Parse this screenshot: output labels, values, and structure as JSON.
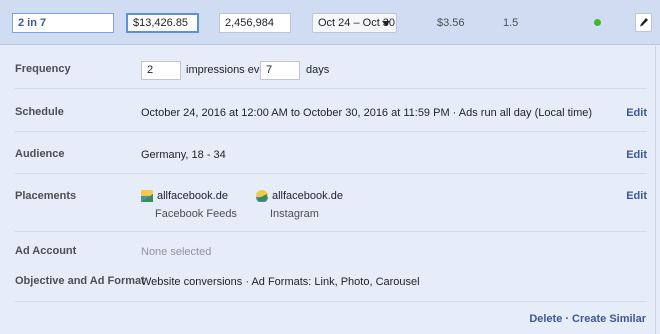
{
  "topbar": {
    "name_value": "2 in 7",
    "bid_value": "$13,426.85",
    "budget_value": "2,456,984",
    "date_range": "Oct 24 – Oct 30",
    "cost": "$3.56",
    "frequency": "1.5",
    "status_color": "#42b72a"
  },
  "frequency": {
    "label": "Frequency",
    "impressions_value": "2",
    "impressions_text": "impressions every",
    "days_value": "7",
    "days_text": "days"
  },
  "schedule": {
    "label": "Schedule",
    "value": "October 24, 2016 at 12:00 AM to October 30, 2016 at 11:59 PM · Ads run all day (Local time)",
    "edit": "Edit"
  },
  "audience": {
    "label": "Audience",
    "value": "Germany, 18 - 34",
    "edit": "Edit"
  },
  "placements": {
    "label": "Placements",
    "items": [
      {
        "name": "allfacebook.de",
        "platform": "Facebook Feeds",
        "icon": "facebook-page-icon"
      },
      {
        "name": "allfacebook.de",
        "platform": "Instagram",
        "icon": "instagram-account-icon"
      }
    ],
    "edit": "Edit"
  },
  "ad_account": {
    "label": "Ad Account",
    "value": "None selected"
  },
  "objective": {
    "label": "Objective and Ad Format",
    "value": "Website conversions · Ad Formats: Link, Photo, Carousel"
  },
  "footer": {
    "delete": "Delete",
    "separator": "·",
    "create_similar": "Create Similar"
  },
  "colors": {
    "link": "#3b5998",
    "header_bg": "#cfdcf2",
    "panel_bg": "#e6edf8"
  }
}
